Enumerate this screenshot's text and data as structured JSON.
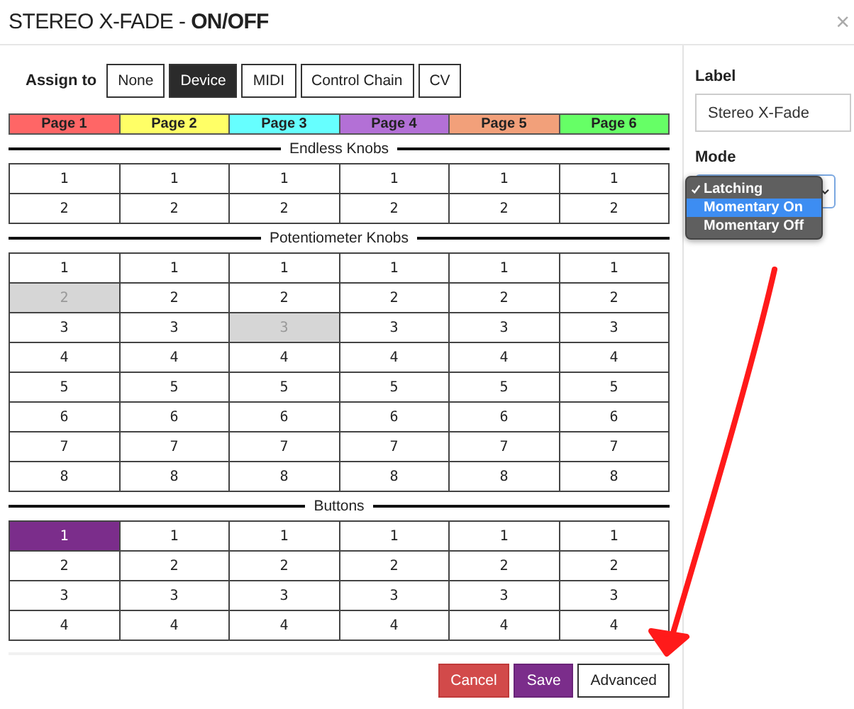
{
  "window": {
    "title_prefix": "STEREO X-FADE - ",
    "title_bold": "ON/OFF",
    "close": "×"
  },
  "assign": {
    "label": "Assign to",
    "options": [
      {
        "label": "None",
        "selected": false
      },
      {
        "label": "Device",
        "selected": true
      },
      {
        "label": "MIDI",
        "selected": false
      },
      {
        "label": "Control Chain",
        "selected": false
      },
      {
        "label": "CV",
        "selected": false
      }
    ]
  },
  "pages": [
    {
      "label": "Page 1",
      "color": "#ff6666"
    },
    {
      "label": "Page 2",
      "color": "#ffff66"
    },
    {
      "label": "Page 3",
      "color": "#66ffff"
    },
    {
      "label": "Page 4",
      "color": "#b370d6"
    },
    {
      "label": "Page 5",
      "color": "#f2a07a"
    },
    {
      "label": "Page 6",
      "color": "#66ff66"
    }
  ],
  "sections": [
    {
      "title": "Endless Knobs",
      "rows": [
        [
          {
            "label": "1",
            "selected": false,
            "disabled": false
          },
          {
            "label": "1",
            "selected": false,
            "disabled": false
          },
          {
            "label": "1",
            "selected": false,
            "disabled": false
          },
          {
            "label": "1",
            "selected": false,
            "disabled": false
          },
          {
            "label": "1",
            "selected": false,
            "disabled": false
          },
          {
            "label": "1",
            "selected": false,
            "disabled": false
          }
        ],
        [
          {
            "label": "2",
            "selected": false,
            "disabled": false
          },
          {
            "label": "2",
            "selected": false,
            "disabled": false
          },
          {
            "label": "2",
            "selected": false,
            "disabled": false
          },
          {
            "label": "2",
            "selected": false,
            "disabled": false
          },
          {
            "label": "2",
            "selected": false,
            "disabled": false
          },
          {
            "label": "2",
            "selected": false,
            "disabled": false
          }
        ]
      ]
    },
    {
      "title": "Potentiometer Knobs",
      "rows": [
        [
          {
            "label": "1",
            "selected": false,
            "disabled": false
          },
          {
            "label": "1",
            "selected": false,
            "disabled": false
          },
          {
            "label": "1",
            "selected": false,
            "disabled": false
          },
          {
            "label": "1",
            "selected": false,
            "disabled": false
          },
          {
            "label": "1",
            "selected": false,
            "disabled": false
          },
          {
            "label": "1",
            "selected": false,
            "disabled": false
          }
        ],
        [
          {
            "label": "2",
            "selected": false,
            "disabled": true
          },
          {
            "label": "2",
            "selected": false,
            "disabled": false
          },
          {
            "label": "2",
            "selected": false,
            "disabled": false
          },
          {
            "label": "2",
            "selected": false,
            "disabled": false
          },
          {
            "label": "2",
            "selected": false,
            "disabled": false
          },
          {
            "label": "2",
            "selected": false,
            "disabled": false
          }
        ],
        [
          {
            "label": "3",
            "selected": false,
            "disabled": false
          },
          {
            "label": "3",
            "selected": false,
            "disabled": false
          },
          {
            "label": "3",
            "selected": false,
            "disabled": true
          },
          {
            "label": "3",
            "selected": false,
            "disabled": false
          },
          {
            "label": "3",
            "selected": false,
            "disabled": false
          },
          {
            "label": "3",
            "selected": false,
            "disabled": false
          }
        ],
        [
          {
            "label": "4",
            "selected": false,
            "disabled": false
          },
          {
            "label": "4",
            "selected": false,
            "disabled": false
          },
          {
            "label": "4",
            "selected": false,
            "disabled": false
          },
          {
            "label": "4",
            "selected": false,
            "disabled": false
          },
          {
            "label": "4",
            "selected": false,
            "disabled": false
          },
          {
            "label": "4",
            "selected": false,
            "disabled": false
          }
        ],
        [
          {
            "label": "5",
            "selected": false,
            "disabled": false
          },
          {
            "label": "5",
            "selected": false,
            "disabled": false
          },
          {
            "label": "5",
            "selected": false,
            "disabled": false
          },
          {
            "label": "5",
            "selected": false,
            "disabled": false
          },
          {
            "label": "5",
            "selected": false,
            "disabled": false
          },
          {
            "label": "5",
            "selected": false,
            "disabled": false
          }
        ],
        [
          {
            "label": "6",
            "selected": false,
            "disabled": false
          },
          {
            "label": "6",
            "selected": false,
            "disabled": false
          },
          {
            "label": "6",
            "selected": false,
            "disabled": false
          },
          {
            "label": "6",
            "selected": false,
            "disabled": false
          },
          {
            "label": "6",
            "selected": false,
            "disabled": false
          },
          {
            "label": "6",
            "selected": false,
            "disabled": false
          }
        ],
        [
          {
            "label": "7",
            "selected": false,
            "disabled": false
          },
          {
            "label": "7",
            "selected": false,
            "disabled": false
          },
          {
            "label": "7",
            "selected": false,
            "disabled": false
          },
          {
            "label": "7",
            "selected": false,
            "disabled": false
          },
          {
            "label": "7",
            "selected": false,
            "disabled": false
          },
          {
            "label": "7",
            "selected": false,
            "disabled": false
          }
        ],
        [
          {
            "label": "8",
            "selected": false,
            "disabled": false
          },
          {
            "label": "8",
            "selected": false,
            "disabled": false
          },
          {
            "label": "8",
            "selected": false,
            "disabled": false
          },
          {
            "label": "8",
            "selected": false,
            "disabled": false
          },
          {
            "label": "8",
            "selected": false,
            "disabled": false
          },
          {
            "label": "8",
            "selected": false,
            "disabled": false
          }
        ]
      ]
    },
    {
      "title": "Buttons",
      "rows": [
        [
          {
            "label": "1",
            "selected": true,
            "disabled": false
          },
          {
            "label": "1",
            "selected": false,
            "disabled": false
          },
          {
            "label": "1",
            "selected": false,
            "disabled": false
          },
          {
            "label": "1",
            "selected": false,
            "disabled": false
          },
          {
            "label": "1",
            "selected": false,
            "disabled": false
          },
          {
            "label": "1",
            "selected": false,
            "disabled": false
          }
        ],
        [
          {
            "label": "2",
            "selected": false,
            "disabled": false
          },
          {
            "label": "2",
            "selected": false,
            "disabled": false
          },
          {
            "label": "2",
            "selected": false,
            "disabled": false
          },
          {
            "label": "2",
            "selected": false,
            "disabled": false
          },
          {
            "label": "2",
            "selected": false,
            "disabled": false
          },
          {
            "label": "2",
            "selected": false,
            "disabled": false
          }
        ],
        [
          {
            "label": "3",
            "selected": false,
            "disabled": false
          },
          {
            "label": "3",
            "selected": false,
            "disabled": false
          },
          {
            "label": "3",
            "selected": false,
            "disabled": false
          },
          {
            "label": "3",
            "selected": false,
            "disabled": false
          },
          {
            "label": "3",
            "selected": false,
            "disabled": false
          },
          {
            "label": "3",
            "selected": false,
            "disabled": false
          }
        ],
        [
          {
            "label": "4",
            "selected": false,
            "disabled": false
          },
          {
            "label": "4",
            "selected": false,
            "disabled": false
          },
          {
            "label": "4",
            "selected": false,
            "disabled": false
          },
          {
            "label": "4",
            "selected": false,
            "disabled": false
          },
          {
            "label": "4",
            "selected": false,
            "disabled": false
          },
          {
            "label": "4",
            "selected": false,
            "disabled": false
          }
        ]
      ]
    }
  ],
  "footer_buttons": [
    {
      "label": "Cancel",
      "kind": "danger"
    },
    {
      "label": "Save",
      "kind": "primary"
    },
    {
      "label": "Advanced",
      "kind": "default"
    }
  ],
  "side": {
    "label_heading": "Label",
    "label_value": "Stereo X-Fade",
    "mode_heading": "Mode",
    "mode_options": [
      {
        "label": "Latching",
        "checked": true,
        "highlighted": false
      },
      {
        "label": "Momentary On",
        "checked": false,
        "highlighted": true
      },
      {
        "label": "Momentary Off",
        "checked": false,
        "highlighted": false
      }
    ]
  }
}
